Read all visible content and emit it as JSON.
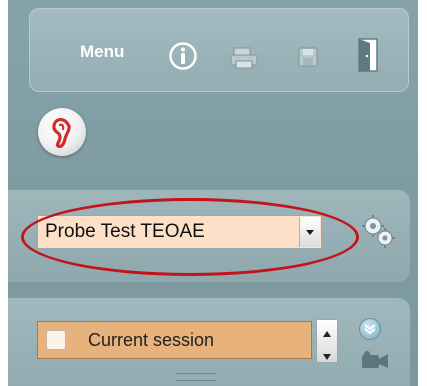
{
  "toolbar": {
    "menu_label": "Menu",
    "icons": [
      "info-icon",
      "print-icon",
      "save-icon",
      "exit-door-icon"
    ]
  },
  "ear_button": {
    "icon": "ear-icon"
  },
  "protocol": {
    "selected": "Probe Test TEOAE",
    "highlight_color": "#c3141c",
    "settings_icon": "gears-icon"
  },
  "session": {
    "label": "Current session",
    "collapse_icon": "chevron-down-icon",
    "record_icon": "camera-icon"
  }
}
